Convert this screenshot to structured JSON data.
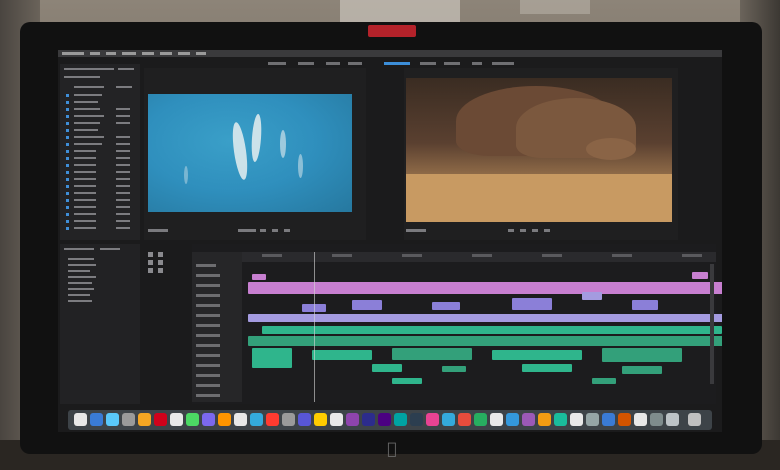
{
  "scene": {
    "description_free": true,
    "monitor_badge_color": "#b4222a",
    "screen": {
      "app": "video-editor",
      "accent_color": "#3c8ed8",
      "timeline_clip_colors": {
        "video_top": "#c77fd0",
        "video_mid": "#8b7fd8",
        "audio": "#2fb58c"
      }
    },
    "icons": {
      "apple": "apple-logo-icon"
    }
  }
}
